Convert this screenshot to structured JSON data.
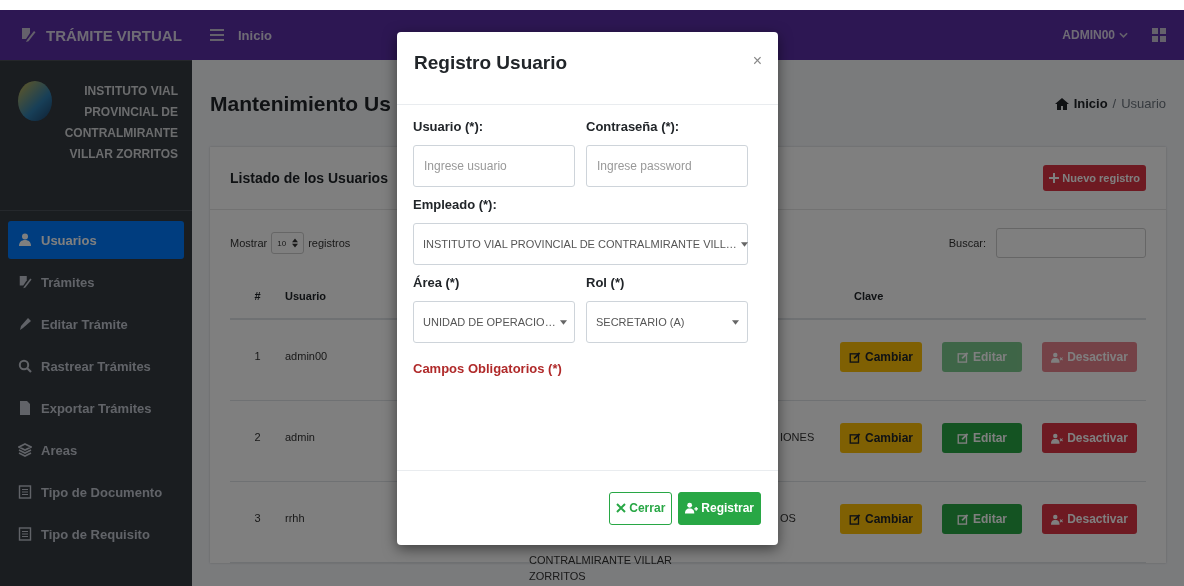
{
  "topbar": {
    "brand": "TRÁMITE VIRTUAL",
    "nav_link": "Inicio",
    "user": "ADMIN00"
  },
  "sidebar": {
    "organization": "INSTITUTO VIAL PROVINCIAL DE CONTRALMIRANTE VILLAR ZORRITOS",
    "items": [
      {
        "label": "Usuarios",
        "kind": "user",
        "selected": true
      },
      {
        "label": "Trámites",
        "kind": "document",
        "selected": false
      },
      {
        "label": "Editar Trámite",
        "kind": "pen",
        "selected": false
      },
      {
        "label": "Rastrear Trámites",
        "kind": "search",
        "selected": false
      },
      {
        "label": "Exportar Trámites",
        "kind": "file",
        "selected": false
      },
      {
        "label": "Areas",
        "kind": "layers",
        "selected": false
      },
      {
        "label": "Tipo de Documento",
        "kind": "list",
        "selected": false
      },
      {
        "label": "Tipo de Requisito",
        "kind": "list",
        "selected": false
      }
    ]
  },
  "page": {
    "title": "Mantenimiento Us",
    "breadcrumb": {
      "home": "Inicio",
      "separator": "/",
      "current": "Usuario"
    }
  },
  "card": {
    "title": "Listado de los Usuarios",
    "new_button": "Nuevo registro",
    "length": {
      "prefix": "Mostrar",
      "value": "10",
      "suffix": "registros"
    },
    "search_label": "Buscar:"
  },
  "table": {
    "columns": {
      "number": "#",
      "user": "Usuario",
      "key": "Clave"
    },
    "rows": [
      {
        "number": "1",
        "user": "admin00",
        "actions": [
          {
            "kind": "change",
            "label": "Cambiar",
            "disabled": false
          },
          {
            "kind": "edit",
            "label": "Editar",
            "disabled": true
          },
          {
            "kind": "deactivate",
            "label": "Desactivar",
            "disabled": true
          }
        ]
      },
      {
        "number": "2",
        "user": "admin",
        "column_4": "IONES",
        "actions": [
          {
            "kind": "change",
            "label": "Cambiar",
            "disabled": false
          },
          {
            "kind": "edit",
            "label": "Editar",
            "disabled": false
          },
          {
            "kind": "deactivate",
            "label": "Desactivar",
            "disabled": false
          }
        ]
      },
      {
        "number": "3",
        "user": "rrhh",
        "column_3": "CONTRALMIRANTE VILLAR ZORRITOS",
        "column_4": "OS",
        "actions": [
          {
            "kind": "change",
            "label": "Cambiar",
            "disabled": false
          },
          {
            "kind": "edit",
            "label": "Editar",
            "disabled": false
          },
          {
            "kind": "deactivate",
            "label": "Desactivar",
            "disabled": false
          }
        ]
      }
    ]
  },
  "modal": {
    "title": "Registro Usuario",
    "close": "×",
    "rows": [
      [
        {
          "kind": "input",
          "label": "Usuario (*):",
          "placeholder": "Ingrese usuario"
        },
        {
          "kind": "input",
          "label": "Contraseña (*):",
          "placeholder": "Ingrese password"
        }
      ],
      [
        {
          "kind": "select",
          "label": "Empleado (*):",
          "value": "INSTITUTO VIAL PROVINCIAL DE CONTRALMIRANTE VILL…"
        }
      ],
      [
        {
          "kind": "select",
          "label": "Área (*)",
          "value": "UNIDAD DE OPERACIO…"
        },
        {
          "kind": "select",
          "label": "Rol (*)",
          "value": "SECRETARIO (A)"
        }
      ]
    ],
    "required_note": "Campos Obligatorios (*)",
    "buttons": [
      {
        "kind": "close",
        "label": "Cerrar"
      },
      {
        "kind": "register",
        "label": "Registrar"
      }
    ]
  }
}
